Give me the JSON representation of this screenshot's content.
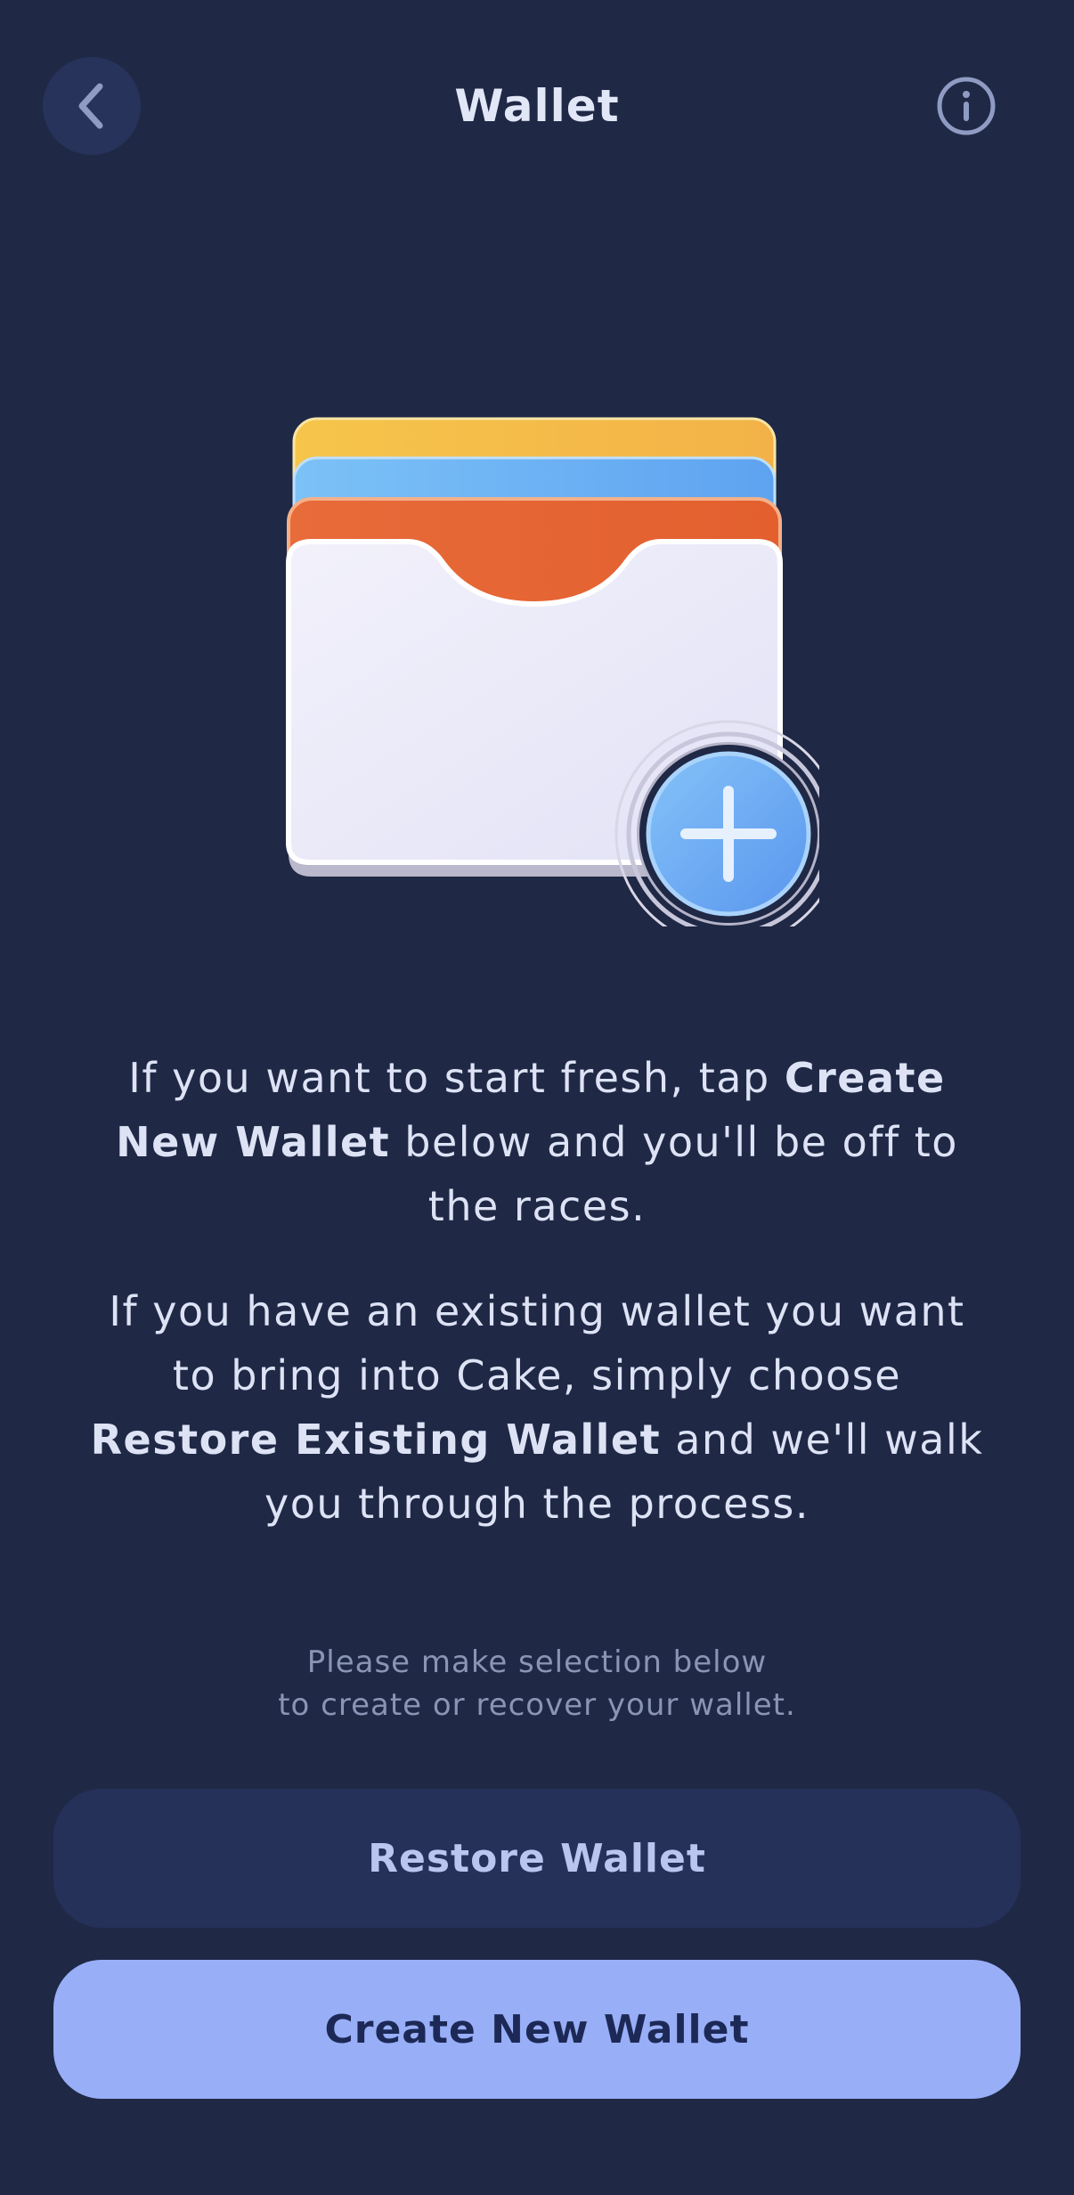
{
  "header": {
    "title": "Wallet",
    "back_icon": "chevron-left-icon",
    "info_icon": "info-icon"
  },
  "illustration": {
    "icon": "wallet-add-icon",
    "colors": {
      "card_yellow": "#f5c64a",
      "card_blue": "#6fb5f5",
      "card_orange": "#e8673a",
      "pocket": "#ececf8",
      "plus_badge": "#6aa8f2"
    }
  },
  "description": {
    "p1_pre": "If you want to start fresh, tap ",
    "p1_bold": "Create New Wallet",
    "p1_post": " below and you'll be off to the races.",
    "p2_pre": "If you have an existing wallet you want to bring into Cake, simply choose ",
    "p2_bold": "Restore Existing Wallet",
    "p2_post": " and we'll walk you through the process."
  },
  "hint": {
    "line1": "Please make selection below",
    "line2": "to create or recover your wallet."
  },
  "buttons": {
    "restore_label": "Restore Wallet",
    "create_label": "Create New Wallet"
  },
  "colors": {
    "background": "#1f2845",
    "restore_button_bg": "#26315a",
    "create_button_bg": "#98aef7"
  }
}
